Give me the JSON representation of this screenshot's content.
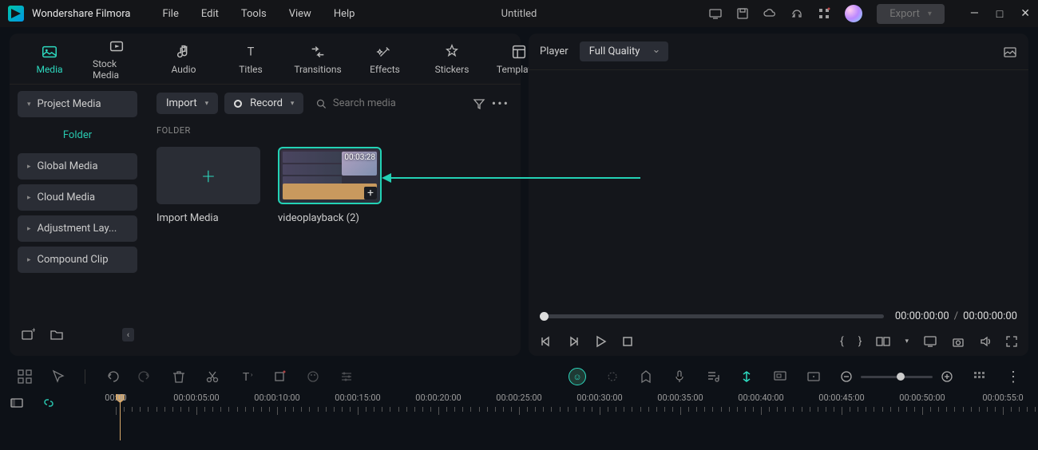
{
  "app_name": "Wondershare Filmora",
  "menu": [
    "File",
    "Edit",
    "Tools",
    "View",
    "Help"
  ],
  "project_title": "Untitled",
  "export_label": "Export",
  "asset_tabs": [
    {
      "label": "Media"
    },
    {
      "label": "Stock Media"
    },
    {
      "label": "Audio"
    },
    {
      "label": "Titles"
    },
    {
      "label": "Transitions"
    },
    {
      "label": "Effects"
    },
    {
      "label": "Stickers"
    },
    {
      "label": "Templates"
    }
  ],
  "sidebar": {
    "project_media": "Project Media",
    "folder": "Folder",
    "global_media": "Global Media",
    "cloud_media": "Cloud Media",
    "adjustment": "Adjustment Lay...",
    "compound": "Compound Clip"
  },
  "content": {
    "import_btn": "Import",
    "record_btn": "Record",
    "search_placeholder": "Search media",
    "section": "FOLDER",
    "import_tile": "Import Media",
    "clip_name": "videoplayback (2)",
    "clip_duration": "00:03:28"
  },
  "player": {
    "label": "Player",
    "quality": "Full Quality",
    "current": "00:00:00:00",
    "total": "00:00:00:00"
  },
  "ruler": [
    "00:00",
    "00:00:05:00",
    "00:00:10:00",
    "00:00:15:00",
    "00:00:20:00",
    "00:00:25:00",
    "00:00:30:00",
    "00:00:35:00",
    "00:00:40:00",
    "00:00:45:00",
    "00:00:50:00",
    "00:00:55:0"
  ]
}
